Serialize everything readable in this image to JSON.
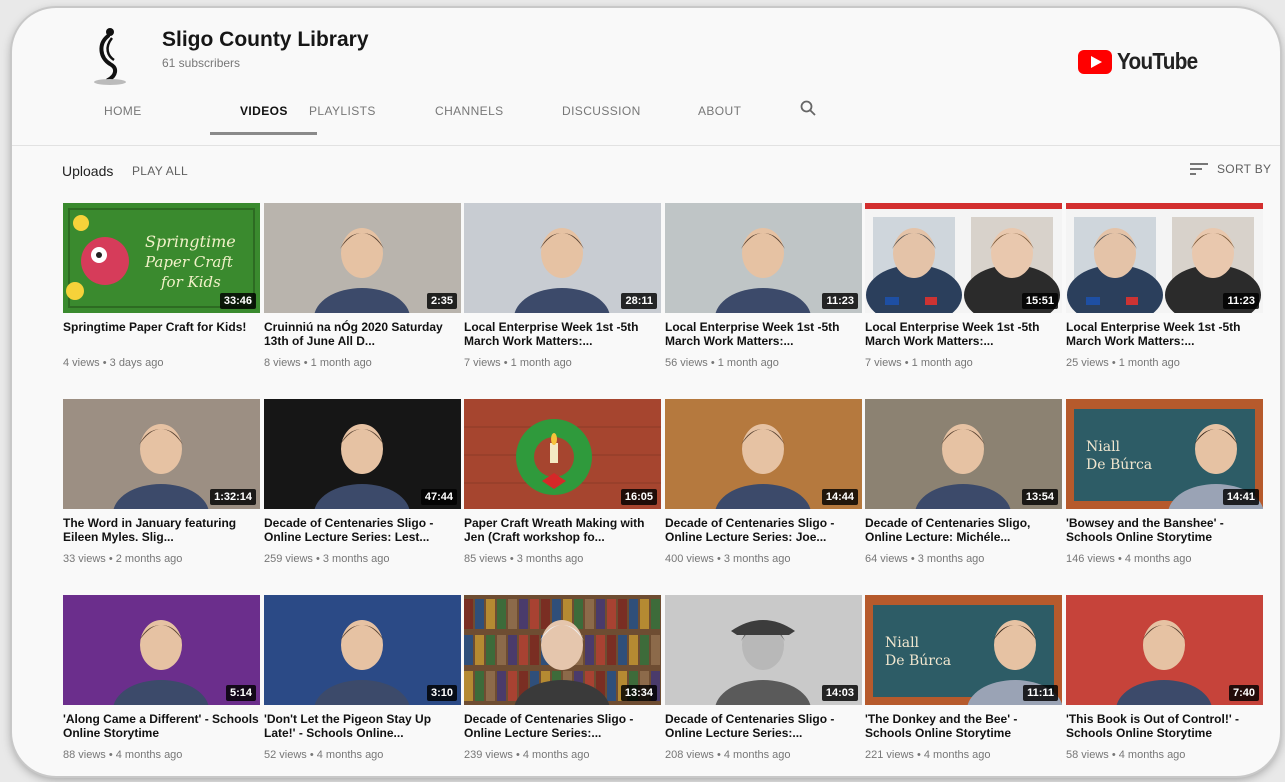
{
  "channel": {
    "name": "Sligo County Library",
    "subscribers": "61 subscribers"
  },
  "brand": {
    "logo_text": "YouTube",
    "accent": "#ff0000"
  },
  "tabs": [
    {
      "label": "HOME",
      "active": false
    },
    {
      "label": "VIDEOS",
      "active": true
    },
    {
      "label": "PLAYLISTS",
      "active": false
    },
    {
      "label": "CHANNELS",
      "active": false
    },
    {
      "label": "DISCUSSION",
      "active": false
    },
    {
      "label": "ABOUT",
      "active": false
    }
  ],
  "uploads": {
    "title": "Uploads",
    "play_all": "PLAY ALL",
    "sort_label": "SORT BY"
  },
  "videos": [
    {
      "title": "Springtime Paper Craft for Kids!",
      "meta": "4 views • 3 days ago",
      "duration": "33:46",
      "thumb": {
        "bg": "#3a8a2e",
        "theme": "craft",
        "text1": "Springtime",
        "text2": "Paper Craft",
        "text3": "for Kids"
      }
    },
    {
      "title": "Cruinniú na nÓg 2020 Saturday 13th of June All D...",
      "meta": "8 views • 1 month ago",
      "duration": "2:35",
      "thumb": {
        "bg": "#b9b4ad",
        "theme": "person"
      }
    },
    {
      "title": "Local Enterprise Week 1st -5th March Work Matters:...",
      "meta": "7 views • 1 month ago",
      "duration": "28:11",
      "thumb": {
        "bg": "#c8ccd2",
        "theme": "person"
      }
    },
    {
      "title": "Local Enterprise Week 1st -5th March Work Matters:...",
      "meta": "56 views • 1 month ago",
      "duration": "11:23",
      "thumb": {
        "bg": "#bfc5c6",
        "theme": "person"
      }
    },
    {
      "title": "Local Enterprise Week 1st -5th March Work Matters:...",
      "meta": "7 views • 1 month ago",
      "duration": "15:51",
      "thumb": {
        "bg": "#f4f4f4",
        "theme": "panel"
      }
    },
    {
      "title": "Local Enterprise Week 1st -5th March Work Matters:...",
      "meta": "25 views • 1 month ago",
      "duration": "11:23",
      "thumb": {
        "bg": "#f4f4f4",
        "theme": "panel"
      }
    },
    {
      "title": "The Word in January featuring Eileen Myles. Slig...",
      "meta": "33 views • 2 months ago",
      "duration": "1:32:14",
      "thumb": {
        "bg": "#9c8f83",
        "theme": "person"
      }
    },
    {
      "title": "Decade of Centenaries Sligo - Online Lecture Series: Lest...",
      "meta": "259 views • 3 months ago",
      "duration": "47:44",
      "thumb": {
        "bg": "#161616",
        "theme": "person"
      }
    },
    {
      "title": "Paper Craft Wreath Making with Jen (Craft workshop fo...",
      "meta": "85 views • 3 months ago",
      "duration": "16:05",
      "thumb": {
        "bg": "#a6452f",
        "theme": "wreath"
      }
    },
    {
      "title": "Decade of Centenaries Sligo - Online Lecture Series: Joe...",
      "meta": "400 views • 3 months ago",
      "duration": "14:44",
      "thumb": {
        "bg": "#b5793e",
        "theme": "person"
      }
    },
    {
      "title": "Decade of Centenaries Sligo, Online Lecture: Michéle...",
      "meta": "64 views • 3 months ago",
      "duration": "13:54",
      "thumb": {
        "bg": "#8c8272",
        "theme": "person"
      }
    },
    {
      "title": "'Bowsey and the Banshee' - Schools Online Storytime",
      "meta": "146 views • 4 months ago",
      "duration": "14:41",
      "thumb": {
        "bg": "#2d5c66",
        "theme": "story",
        "text1": "Niall",
        "text2": "De Búrca"
      }
    },
    {
      "title": "'Along Came a Different' - Schools Online Storytime",
      "meta": "88 views • 4 months ago",
      "duration": "5:14",
      "thumb": {
        "bg": "#6b2e8c",
        "theme": "person"
      }
    },
    {
      "title": "'Don't Let the Pigeon Stay Up Late!' - Schools Online...",
      "meta": "52 views • 4 months ago",
      "duration": "3:10",
      "thumb": {
        "bg": "#2b4a86",
        "theme": "person"
      }
    },
    {
      "title": "Decade of Centenaries Sligo - Online Lecture Series:...",
      "meta": "239 views • 4 months ago",
      "duration": "13:34",
      "thumb": {
        "bg": "#6e4d32",
        "theme": "books"
      }
    },
    {
      "title": "Decade of Centenaries Sligo - Online Lecture Series:...",
      "meta": "208 views • 4 months ago",
      "duration": "14:03",
      "thumb": {
        "bg": "#d0d0d0",
        "theme": "soldier"
      }
    },
    {
      "title": "'The Donkey and the Bee' - Schools Online Storytime",
      "meta": "221 views • 4 months ago",
      "duration": "11:11",
      "thumb": {
        "bg": "#2d5c66",
        "theme": "story",
        "text1": "Niall",
        "text2": "De Búrca"
      }
    },
    {
      "title": "'This Book is Out of Control!' - Schools Online Storytime",
      "meta": "58 views • 4 months ago",
      "duration": "7:40",
      "thumb": {
        "bg": "#c6433a",
        "theme": "person"
      }
    }
  ]
}
